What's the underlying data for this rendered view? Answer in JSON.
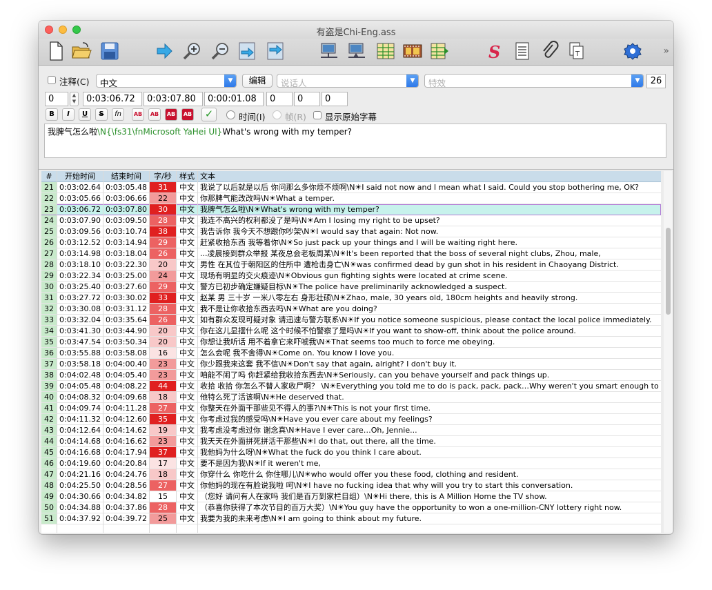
{
  "window": {
    "title": "有盗是Chi-Eng.ass"
  },
  "toolbar": {
    "icons": [
      "new-file-icon",
      "open-folder-icon",
      "save-icon",
      "jump-arrow-icon",
      "zoom-in-icon",
      "zoom-out-icon",
      "jump-start-icon",
      "jump-end-icon",
      "video-frame-start-icon",
      "video-frame-end-icon",
      "grid-icon",
      "film-icon",
      "grid-arrow-icon",
      "style-icon",
      "properties-icon",
      "attachment-icon",
      "fonts-icon",
      "options-icon"
    ],
    "overflow_glyph": "»"
  },
  "edit": {
    "comment_label": "注释(C)",
    "style_value": "中文",
    "edit_button": "编辑",
    "actor_placeholder": "说话人",
    "effect_placeholder": "特效",
    "char_count": "26",
    "layer": "0",
    "start_time": "0:03:06.72",
    "end_time": "0:03:07.80",
    "duration": "0:00:01.08",
    "margin_l": "0",
    "margin_r": "0",
    "margin_v": "0",
    "format_buttons": [
      "B",
      "I",
      "U",
      "S",
      "fn",
      "AB",
      "AB",
      "AB",
      "AB"
    ],
    "commit_check": "✓",
    "time_radio": "时间(I)",
    "frame_radio": "帧(R)",
    "show_original": "显示原始字幕",
    "text_part1": "我脾气怎么啦",
    "text_tag1": "\\N{\\fs31\\fnMicrosoft YaHei UI}",
    "text_part2": "What's wrong with my temper?"
  },
  "grid": {
    "headers": {
      "num": "#",
      "start": "开始时间",
      "end": "结束时间",
      "cps": "字/秒",
      "style": "样式",
      "text": "文本"
    },
    "selected_row": 23,
    "rows": [
      {
        "num": "21",
        "start": "0:03:02.64",
        "end": "0:03:05.48",
        "cps": "31",
        "style": "中文",
        "text": "我说了以后就是以后 你问那么多你烦不烦啊\\N☀I said not now and I mean what I said. Could you stop bothering me, OK?"
      },
      {
        "num": "22",
        "start": "0:03:05.66",
        "end": "0:03:06.66",
        "cps": "22",
        "style": "中文",
        "text": "你那脾气能改改吗\\N☀What a temper."
      },
      {
        "num": "23",
        "start": "0:03:06.72",
        "end": "0:03:07.80",
        "cps": "30",
        "style": "中文",
        "text": "我脾气怎么啦\\N☀What's wrong with my temper?"
      },
      {
        "num": "24",
        "start": "0:03:07.90",
        "end": "0:03:09.50",
        "cps": "28",
        "style": "中文",
        "text": "我连不高兴的权利都没了是吗\\N☀Am I losing my right to be upset?"
      },
      {
        "num": "25",
        "start": "0:03:09.56",
        "end": "0:03:10.74",
        "cps": "38",
        "style": "中文",
        "text": "我告诉你 我今天不想跟你吵架\\N☀I would say that again: Not now."
      },
      {
        "num": "26",
        "start": "0:03:12.52",
        "end": "0:03:14.94",
        "cps": "29",
        "style": "中文",
        "text": "赶紧收拾东西 我等着你\\N☀So just pack up your things and I will be waiting right here."
      },
      {
        "num": "27",
        "start": "0:03:14.98",
        "end": "0:03:18.04",
        "cps": "26",
        "style": "中文",
        "text": "...凌晨接到群众举报 某夜总会老板周某\\N☀It's been reported that the boss of several night clubs, Zhou, male,"
      },
      {
        "num": "28",
        "start": "0:03:18.10",
        "end": "0:03:22.30",
        "cps": "20",
        "style": "中文",
        "text": "男性 在其位于朝阳区的住所中 遭枪击身亡\\N☀was confirmed dead by gun shot in his resident in Chaoyang District."
      },
      {
        "num": "29",
        "start": "0:03:22.34",
        "end": "0:03:25.00",
        "cps": "24",
        "style": "中文",
        "text": "现场有明显的交火痕迹\\N☀Obvious gun fighting sights were located at crime scene."
      },
      {
        "num": "30",
        "start": "0:03:25.40",
        "end": "0:03:27.60",
        "cps": "29",
        "style": "中文",
        "text": "警方已初步确定嫌疑目标\\N☀The police have preliminarily acknowledged a suspect."
      },
      {
        "num": "31",
        "start": "0:03:27.72",
        "end": "0:03:30.02",
        "cps": "33",
        "style": "中文",
        "text": "赵某 男 三十岁 一米八零左右 身形壮硕\\N☀Zhao, male, 30 years old, 180cm heights and heavily strong."
      },
      {
        "num": "32",
        "start": "0:03:30.08",
        "end": "0:03:31.12",
        "cps": "28",
        "style": "中文",
        "text": "我不是让你收拾东西去吗\\N☀What are you doing?"
      },
      {
        "num": "33",
        "start": "0:03:32.04",
        "end": "0:03:35.64",
        "cps": "26",
        "style": "中文",
        "text": "如有群众发现可疑对象 请迅速与警方联系\\N☀If you notice someone suspicious, please contact the local police immediately."
      },
      {
        "num": "34",
        "start": "0:03:41.30",
        "end": "0:03:44.90",
        "cps": "20",
        "style": "中文",
        "text": "你在这儿显摆什么呢 这个时候不怕警察了是吗\\N☀If you want to show-off, think about the police around."
      },
      {
        "num": "35",
        "start": "0:03:47.54",
        "end": "0:03:50.34",
        "cps": "20",
        "style": "中文",
        "text": "你想让我听话 用不着拿它来吓唬我\\N☀That seems too much to force me obeying."
      },
      {
        "num": "36",
        "start": "0:03:55.88",
        "end": "0:03:58.08",
        "cps": "16",
        "style": "中文",
        "text": "怎么会呢 我不舍得\\N☀Come on. You know I love you."
      },
      {
        "num": "37",
        "start": "0:03:58.18",
        "end": "0:04:00.40",
        "cps": "23",
        "style": "中文",
        "text": "你少跟我来这套 我不信\\N☀Don't say that again, alright? I don't buy it."
      },
      {
        "num": "38",
        "start": "0:04:02.48",
        "end": "0:04:05.40",
        "cps": "23",
        "style": "中文",
        "text": "咱能不闹了吗 你赶紧给我收拾东西去\\N☀Seriously, can you behave yourself and pack things up."
      },
      {
        "num": "39",
        "start": "0:04:05.48",
        "end": "0:04:08.22",
        "cps": "44",
        "style": "中文",
        "text": "收拾 收拾 你怎么不替人家收尸啊？ \\N☀Everything you told me to do is pack, pack, pack…Why weren't you smart enough to p"
      },
      {
        "num": "40",
        "start": "0:04:08.32",
        "end": "0:04:09.68",
        "cps": "18",
        "style": "中文",
        "text": "他特么死了活该啊\\N☀He deserved that."
      },
      {
        "num": "41",
        "start": "0:04:09.74",
        "end": "0:04:11.28",
        "cps": "27",
        "style": "中文",
        "text": "你整天在外面干那些见不得人的事?\\N☀This is not your first time."
      },
      {
        "num": "42",
        "start": "0:04:11.32",
        "end": "0:04:12.60",
        "cps": "35",
        "style": "中文",
        "text": "你考虑过我的感受吗\\N☀Have you ever care about my feelings?"
      },
      {
        "num": "43",
        "start": "0:04:12.64",
        "end": "0:04:14.62",
        "cps": "19",
        "style": "中文",
        "text": "我考虑没考虑过你 谢念真\\N☀Have I ever care…Oh, Jennie..."
      },
      {
        "num": "44",
        "start": "0:04:14.68",
        "end": "0:04:16.62",
        "cps": "23",
        "style": "中文",
        "text": "我天天在外面拼死拼活干那些\\N☀I do that, out there, all the time."
      },
      {
        "num": "45",
        "start": "0:04:16.68",
        "end": "0:04:17.94",
        "cps": "37",
        "style": "中文",
        "text": "我他妈为什么呀\\N☀What the fuck do you think I care about."
      },
      {
        "num": "46",
        "start": "0:04:19.60",
        "end": "0:04:20.84",
        "cps": "17",
        "style": "中文",
        "text": "要不是因为我\\N☀If it weren't me,"
      },
      {
        "num": "47",
        "start": "0:04:21.16",
        "end": "0:04:24.76",
        "cps": "18",
        "style": "中文",
        "text": "你穿什么 你吃什么 你住哪儿\\N☀who would offer you these food, clothing and resident."
      },
      {
        "num": "48",
        "start": "0:04:25.50",
        "end": "0:04:28.56",
        "cps": "27",
        "style": "中文",
        "text": "你他妈的现在有脸说我啦 呵\\N☀I have no fucking idea that why will you try to start this conversation."
      },
      {
        "num": "49",
        "start": "0:04:30.66",
        "end": "0:04:34.82",
        "cps": "15",
        "style": "中文",
        "text": "（您好 请问有人在家吗 我们是百万到家栏目组）\\N☀Hi there, this is A Million Home the TV show."
      },
      {
        "num": "50",
        "start": "0:04:34.88",
        "end": "0:04:37.86",
        "cps": "28",
        "style": "中文",
        "text": "（恭喜你获得了本次节目的百万大奖）\\N☀You guy have the opportunity to won a one-million-CNY lottery right now."
      },
      {
        "num": "51",
        "start": "0:04:37.92",
        "end": "0:04:39.72",
        "cps": "25",
        "style": "中文",
        "text": "我要为我的未来考虑\\N☀I am going to think about my future."
      }
    ]
  }
}
